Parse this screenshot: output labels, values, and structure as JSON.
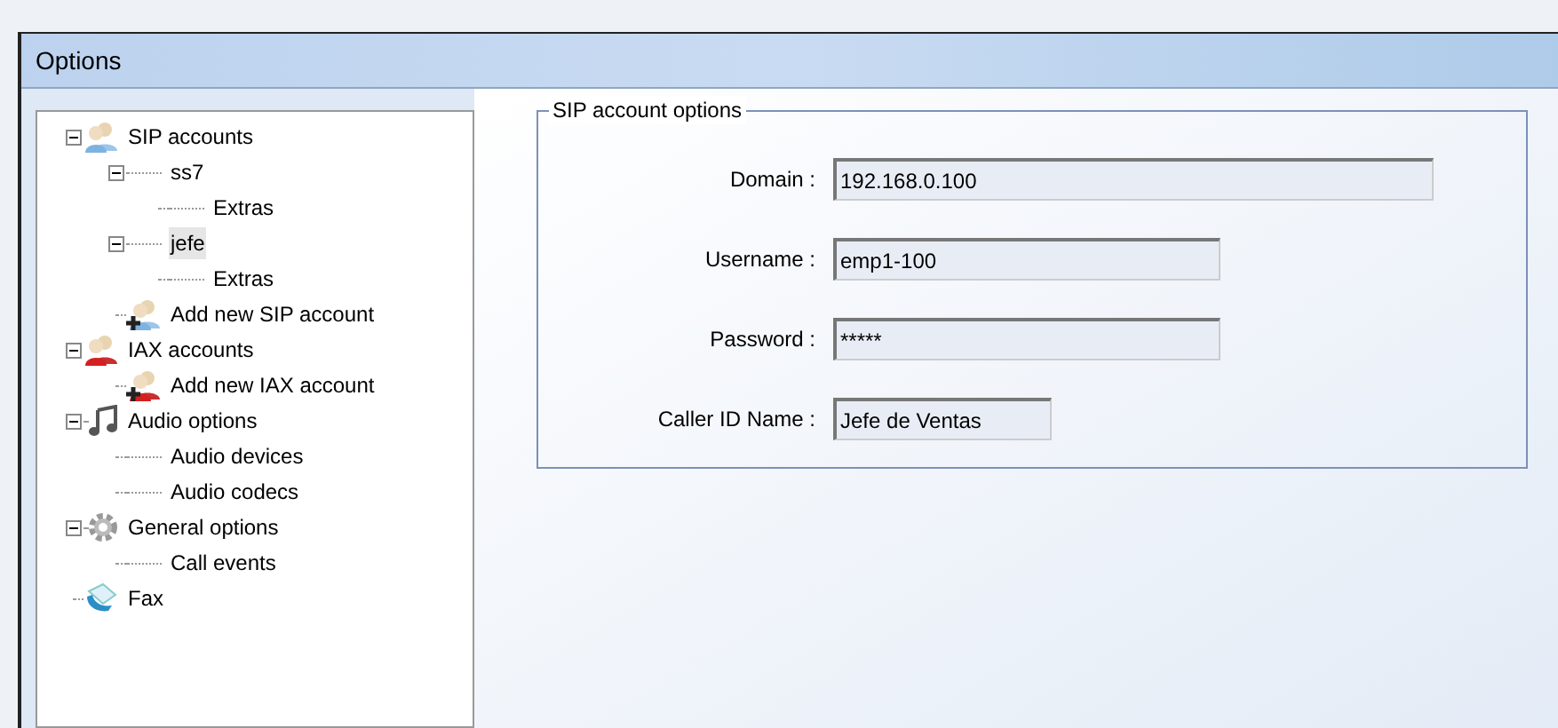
{
  "window": {
    "title": "Options"
  },
  "tree": [
    {
      "label": "SIP accounts",
      "kind": "sip",
      "expanded": true,
      "selected": false,
      "children": [
        {
          "label": "ss7",
          "expanded": true,
          "selected": false,
          "children": [
            {
              "label": "Extras",
              "selected": false
            }
          ]
        },
        {
          "label": "jefe",
          "expanded": true,
          "selected": true,
          "children": [
            {
              "label": "Extras",
              "selected": false
            }
          ]
        },
        {
          "label": "Add new SIP account",
          "kind": "sip-add",
          "selected": false
        }
      ]
    },
    {
      "label": "IAX accounts",
      "kind": "iax",
      "expanded": true,
      "selected": false,
      "children": [
        {
          "label": "Add new IAX account",
          "kind": "iax-add",
          "selected": false
        }
      ]
    },
    {
      "label": "Audio options",
      "kind": "audio",
      "expanded": true,
      "selected": false,
      "children": [
        {
          "label": "Audio devices",
          "selected": false
        },
        {
          "label": "Audio codecs",
          "selected": false
        }
      ]
    },
    {
      "label": "General options",
      "kind": "general",
      "expanded": true,
      "selected": false,
      "children": [
        {
          "label": "Call events",
          "selected": false
        }
      ]
    },
    {
      "label": "Fax",
      "kind": "fax",
      "selected": false
    }
  ],
  "group": {
    "title": "SIP account options",
    "fields": [
      {
        "label": "Domain :",
        "value": "192.168.0.100"
      },
      {
        "label": "Username :",
        "value": "emp1-100"
      },
      {
        "label": "Password :",
        "value": "*****"
      },
      {
        "label": "Caller ID Name :",
        "value": "Jefe de Ventas"
      }
    ]
  }
}
